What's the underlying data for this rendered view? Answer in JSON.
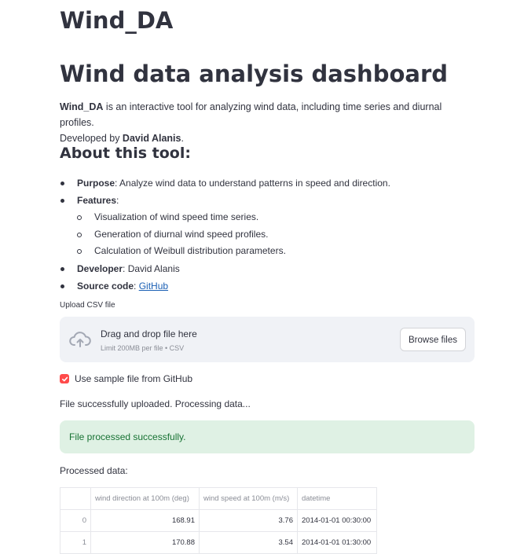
{
  "app_title": "Wind_DA",
  "dashboard_title": "Wind data analysis dashboard",
  "intro": {
    "name": "Wind_DA",
    "description": " is an interactive tool for analyzing wind data, including time series and diurnal profiles.",
    "developed_prefix": "Developed by ",
    "developer": "David Alanis",
    "developed_suffix": "."
  },
  "about_heading": "About this tool:",
  "about": {
    "purpose_label": "Purpose",
    "purpose_text": ": Analyze wind data to understand patterns in speed and direction.",
    "features_label": "Features",
    "features_suffix": ":",
    "features": [
      "Visualization of wind speed time series.",
      "Generation of diurnal wind speed profiles.",
      "Calculation of Weibull distribution parameters."
    ],
    "developer_label": "Developer",
    "developer_text": ": David Alanis",
    "source_label": "Source code",
    "source_sep": ": ",
    "source_link": "GitHub"
  },
  "uploader": {
    "label": "Upload CSV file",
    "drag_text": "Drag and drop file here",
    "limit_text": "Limit 200MB per file • CSV",
    "browse_button": "Browse files",
    "icon": "cloud-upload-icon"
  },
  "sample_checkbox": {
    "label": "Use sample file from GitHub",
    "checked": true,
    "color": "#ff4b4b"
  },
  "status_text": "File successfully uploaded. Processing data...",
  "success_alert": "File processed successfully.",
  "processed_label": "Processed data:",
  "table": {
    "columns": [
      "",
      "wind direction at 100m (deg)",
      "wind speed at 100m (m/s)",
      "datetime"
    ],
    "rows": [
      [
        "0",
        "168.91",
        "3.76",
        "2014-01-01 00:30:00"
      ],
      [
        "1",
        "170.88",
        "3.54",
        "2014-01-01 01:30:00"
      ]
    ]
  }
}
